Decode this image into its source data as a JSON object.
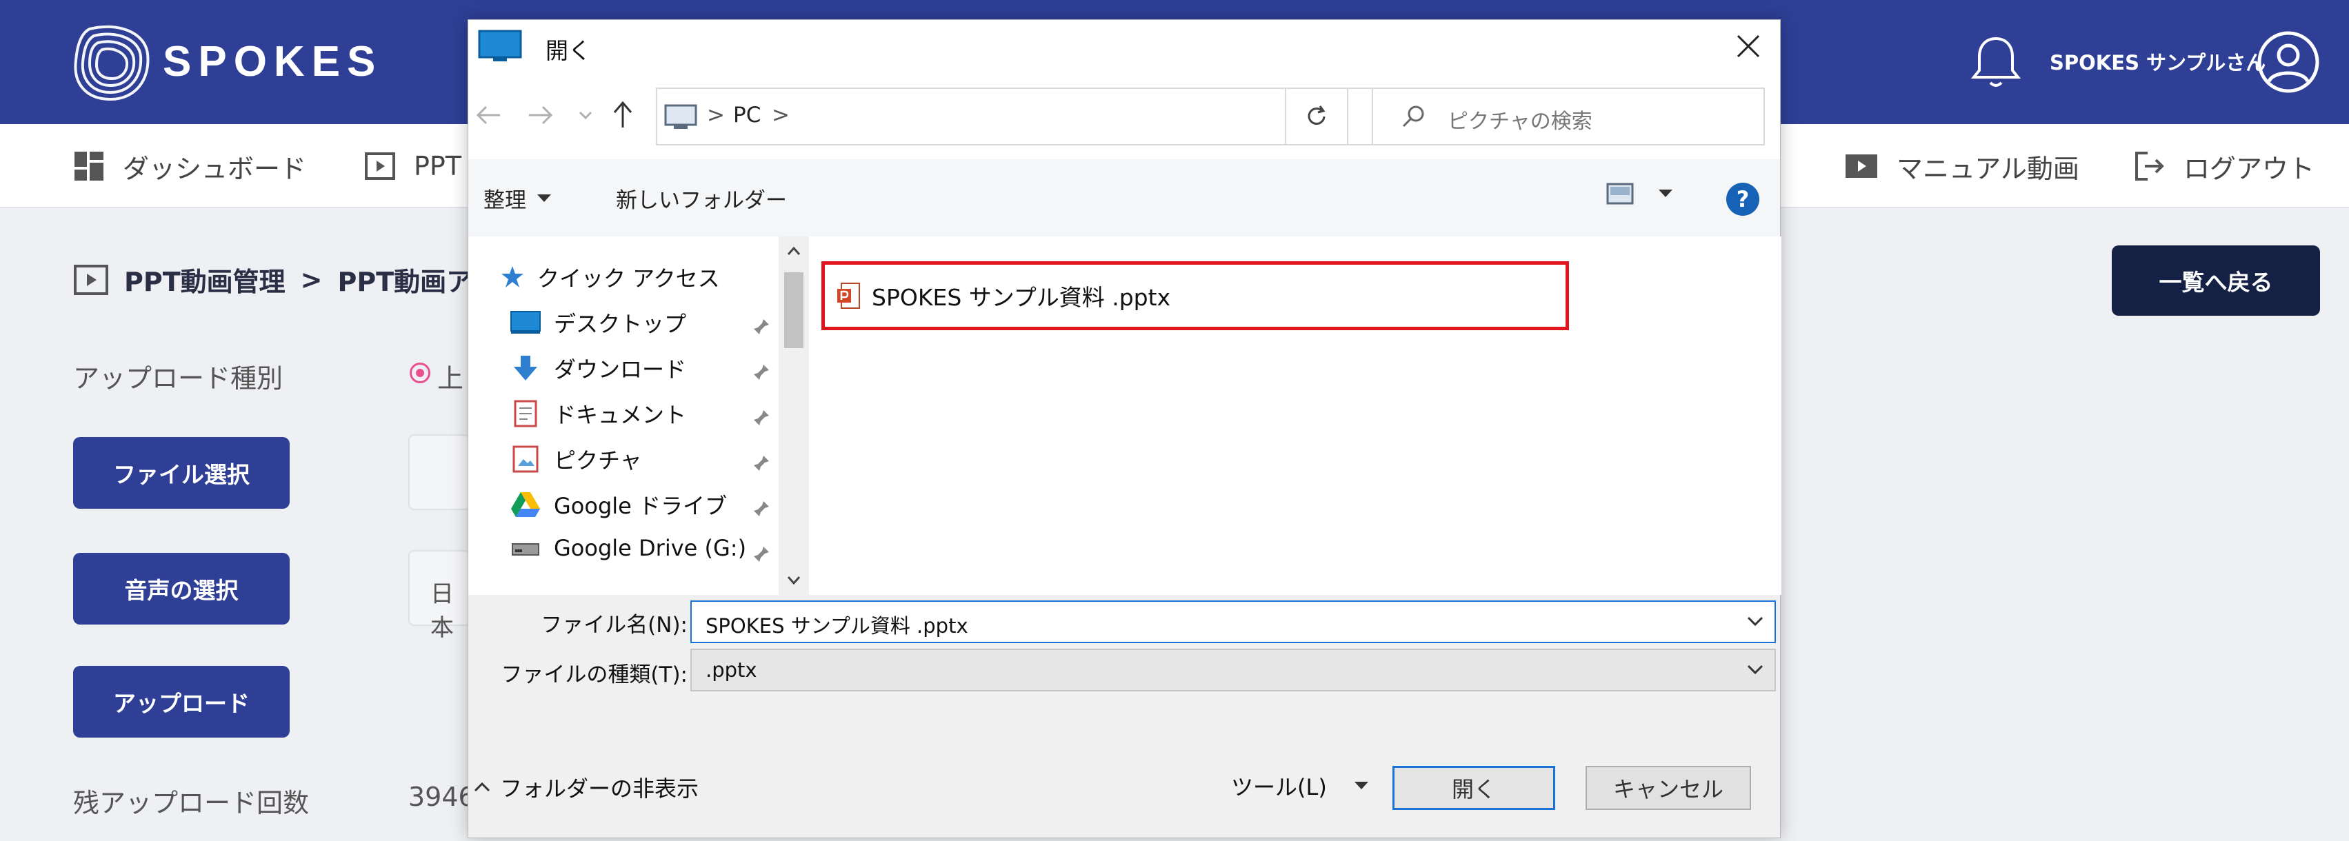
{
  "app": {
    "logo_text": "SPOKES",
    "user_name": "SPOKES サンプルさん",
    "nav": {
      "dashboard": "ダッシュボード",
      "ppt": "PPT",
      "manual_video": "マニュアル動画",
      "logout": "ログアウト"
    },
    "breadcrumb": {
      "first": "PPT動画管理",
      "separator": ">",
      "second": "PPT動画ア"
    },
    "back_button": "一覧へ戻る",
    "upload_type_label": "アップロード種別",
    "radio_label": "上",
    "file_select_button": "ファイル選択",
    "voice_select_button": "音声の選択",
    "voice_field_value": "日本",
    "upload_button": "アップロード",
    "remaining_label": "残アップロード回数",
    "remaining_value": "3946",
    "colors": {
      "primary": "#2e3f95",
      "dark_navy": "#152045",
      "radio_accent": "#e8508f"
    }
  },
  "dialog": {
    "title": "開く",
    "address": {
      "location": "PC",
      "sep": ">"
    },
    "search_placeholder": "ピクチャの検索",
    "organize": "整理",
    "new_folder": "新しいフォルダー",
    "help": "?",
    "nav_items": [
      {
        "label": "クイック アクセス",
        "icon": "star-icon"
      },
      {
        "label": "デスクトップ",
        "icon": "desktop-icon"
      },
      {
        "label": "ダウンロード",
        "icon": "download-icon"
      },
      {
        "label": "ドキュメント",
        "icon": "document-icon"
      },
      {
        "label": "ピクチャ",
        "icon": "pictures-icon"
      },
      {
        "label": "Google ドライブ",
        "icon": "google-drive-icon"
      },
      {
        "label": "Google Drive (G:)",
        "icon": "drive-icon"
      }
    ],
    "file": {
      "name": "SPOKES サンプル資料 .pptx",
      "icon": "pptx-icon",
      "highlight_color": "#e0141c"
    },
    "filename_label": "ファイル名(N):",
    "filename_value": "SPOKES サンプル資料 .pptx",
    "filetype_label": "ファイルの種類(T):",
    "filetype_value": ".pptx",
    "hide_folders": "フォルダーの非表示",
    "tools": "ツール(L)",
    "open_button": "開く",
    "cancel_button": "キャンセル"
  }
}
